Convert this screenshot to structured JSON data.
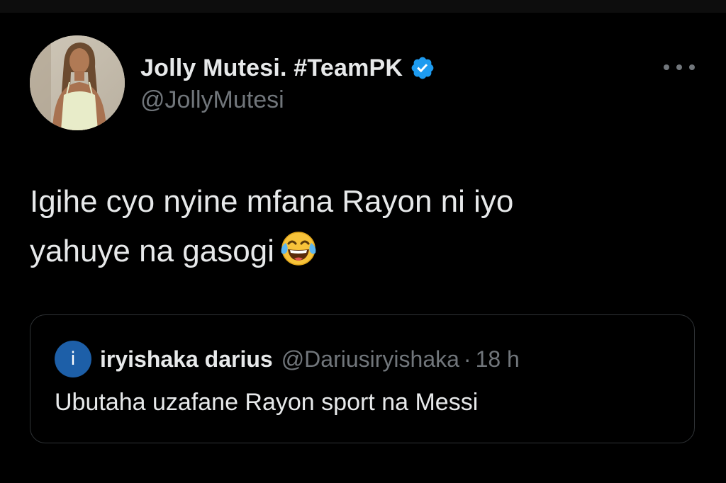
{
  "tweet": {
    "author": {
      "display_name": "Jolly Mutesi. #TeamPK",
      "handle": "@JollyMutesi",
      "verified": true,
      "avatar": "profile-photo"
    },
    "more_icon": "more-horizontal-icon",
    "text_line1": "Igihe cyo nyine mfana Rayon ni iyo",
    "text_line2": "yahuye na gasogi",
    "emoji": "face-with-tears-of-joy"
  },
  "quoted_tweet": {
    "avatar_letter": "i",
    "display_name": "iryishaka darius",
    "handle": "@Dariusiryishaka",
    "separator": "·",
    "time": "18 h",
    "text": "Ubutaha uzafane Rayon sport na Messi"
  },
  "colors": {
    "background": "#000000",
    "text_primary": "#e7e9ea",
    "text_secondary": "#71767b",
    "verified_blue": "#1d9bf0",
    "border": "#2f3336"
  }
}
